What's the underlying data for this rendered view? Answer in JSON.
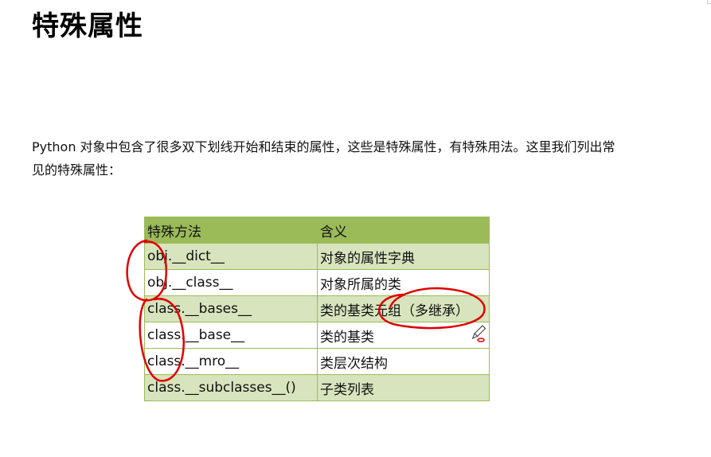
{
  "page": {
    "title": "特殊属性",
    "intro": "Python 对象中包含了很多双下划线开始和结束的属性，这些是特殊属性，有特殊用法。这里我们列出常见的特殊属性："
  },
  "table": {
    "headers": [
      "特殊方法",
      "含义"
    ],
    "rows": [
      {
        "method": "obj.__dict__",
        "meaning": "对象的属性字典"
      },
      {
        "method": "obj.__class__",
        "meaning": "对象所属的类"
      },
      {
        "method": "class.__bases__",
        "meaning": "类的基类元组（多继承）"
      },
      {
        "method": "class.__base__",
        "meaning": "类的基类"
      },
      {
        "method": "class.__mro__",
        "meaning": "类层次结构"
      },
      {
        "method": "class.__subclasses__()",
        "meaning": "子类列表"
      }
    ]
  },
  "colors": {
    "header_bg": "#9bbb59",
    "row_shade": "#d7e4bd",
    "annotation": "#e00000"
  },
  "icons": [
    "pen-cursor-icon"
  ]
}
